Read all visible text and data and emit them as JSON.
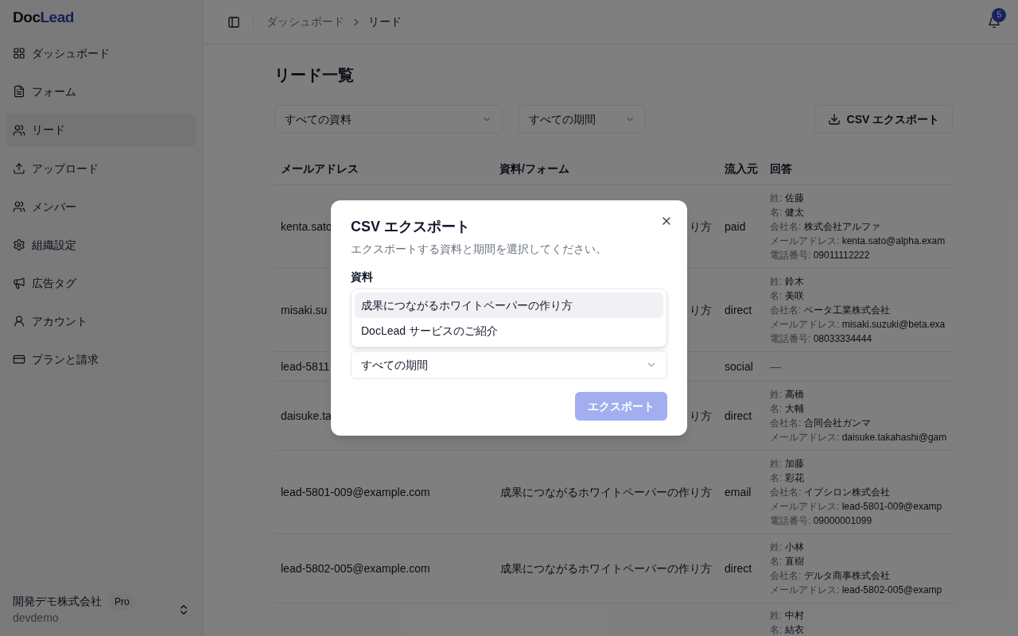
{
  "sidebar": {
    "logo": {
      "part1": "Doc",
      "part2": "Lead"
    },
    "items": [
      {
        "label": "ダッシュボード",
        "selected": false
      },
      {
        "label": "フォーム",
        "selected": false
      },
      {
        "label": "リード",
        "selected": true
      },
      {
        "label": "アップロード",
        "selected": false
      },
      {
        "label": "メンバー",
        "selected": false
      },
      {
        "label": "組織設定",
        "selected": false
      },
      {
        "label": "広告タグ",
        "selected": false
      },
      {
        "label": "アカウント",
        "selected": false
      },
      {
        "label": "プランと請求",
        "selected": false
      }
    ],
    "org": {
      "name": "開発デモ株式会社",
      "plan": "Pro",
      "slug": "devdemo"
    }
  },
  "header": {
    "breadcrumb": [
      "ダッシュボード",
      "リード"
    ],
    "notifications": "5"
  },
  "page": {
    "title": "リード一覧",
    "filters": [
      "すべての資料",
      "すべての期間"
    ],
    "export_button": "CSV エクスポート"
  },
  "table": {
    "columns": [
      "メールアドレス",
      "資料/フォーム",
      "流入元",
      "回答"
    ],
    "rows": [
      {
        "email": "kenta.sato",
        "form": "り方",
        "source": "paid",
        "answers": [
          {
            "label": "姓:",
            "value": "佐藤"
          },
          {
            "label": "名:",
            "value": "健太"
          },
          {
            "label": "会社名:",
            "value": "株式会社アルファ"
          },
          {
            "label": "メールアドレス:",
            "value": "kenta.sato@alpha.exam"
          },
          {
            "label": "電話番号:",
            "value": "09011112222"
          }
        ]
      },
      {
        "email": "misaki.su",
        "form": "り方",
        "source": "direct",
        "answers": [
          {
            "label": "姓:",
            "value": "鈴木"
          },
          {
            "label": "名:",
            "value": "美咲"
          },
          {
            "label": "会社名:",
            "value": "ベータ工業株式会社"
          },
          {
            "label": "メールアドレス:",
            "value": "misaki.suzuki@beta.exa"
          },
          {
            "label": "電話番号:",
            "value": "08033334444"
          }
        ]
      },
      {
        "email": "lead-5811",
        "source": "social",
        "empty_answer": "—"
      },
      {
        "email": "daisuke.ta",
        "form": "り方",
        "source": "direct",
        "answers": [
          {
            "label": "姓:",
            "value": "高橋"
          },
          {
            "label": "名:",
            "value": "大輔"
          },
          {
            "label": "会社名:",
            "value": "合同会社ガンマ"
          },
          {
            "label": "メールアドレス:",
            "value": "daisuke.takahashi@gam"
          }
        ]
      },
      {
        "email": "lead-5801-009@example.com",
        "form": "成果につながるホワイトペーパーの作り方",
        "source": "email",
        "answers": [
          {
            "label": "姓:",
            "value": "加藤"
          },
          {
            "label": "名:",
            "value": "彩花"
          },
          {
            "label": "会社名:",
            "value": "イプシロン株式会社"
          },
          {
            "label": "メールアドレス:",
            "value": "lead-5801-009@examp"
          },
          {
            "label": "電話番号:",
            "value": "09000001099"
          }
        ]
      },
      {
        "email": "lead-5802-005@example.com",
        "form": "成果につながるホワイトペーパーの作り方",
        "source": "direct",
        "answers": [
          {
            "label": "姓:",
            "value": "小林"
          },
          {
            "label": "名:",
            "value": "直樹"
          },
          {
            "label": "会社名:",
            "value": "デルタ商事株式会社"
          },
          {
            "label": "メールアドレス:",
            "value": "lead-5802-005@examp"
          }
        ]
      },
      {
        "answers": [
          {
            "label": "姓:",
            "value": "中村"
          },
          {
            "label": "名:",
            "value": "結衣"
          }
        ]
      }
    ]
  },
  "dialog": {
    "title": "CSV エクスポート",
    "description": "エクスポートする資料と期間を選択してください。",
    "field_label": "資料",
    "options": [
      {
        "label": "成果につながるホワイトペーパーの作り方",
        "selected": true
      },
      {
        "label": "DocLead サービスのご紹介",
        "selected": false
      }
    ],
    "period": "すべての期間",
    "submit": {
      "label": "エクスポート",
      "disabled": true
    }
  }
}
